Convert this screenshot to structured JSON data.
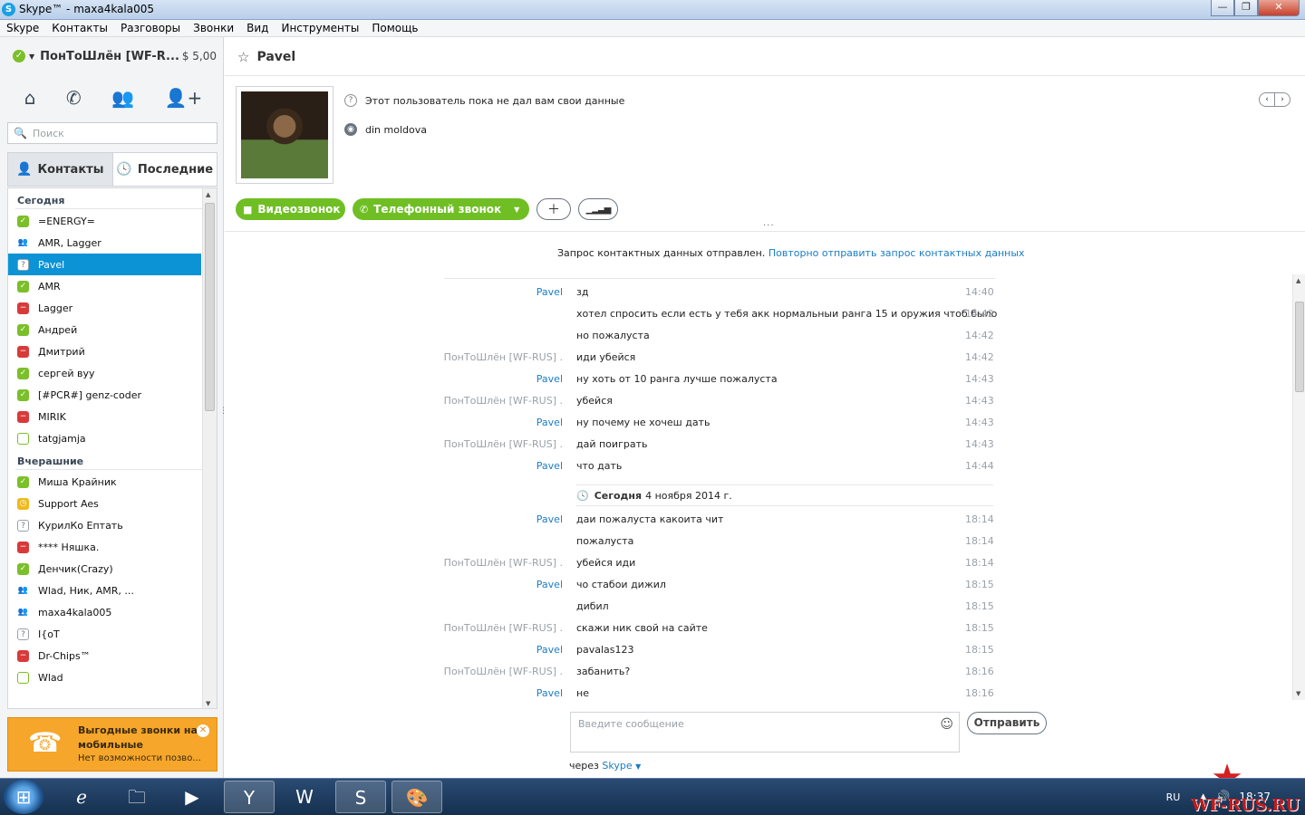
{
  "window": {
    "title": "Skype™ - maxa4kala005",
    "app_icon": "S"
  },
  "menu": [
    "Skype",
    "Контакты",
    "Разговоры",
    "Звонки",
    "Вид",
    "Инструменты",
    "Помощь"
  ],
  "account": {
    "name": "ПонТоШлён [WF-R...",
    "balance": "$ 5,00"
  },
  "search": {
    "placeholder": "Поиск"
  },
  "tabs": {
    "contacts": "Контакты",
    "recent": "Последние"
  },
  "contacts": {
    "today_header": "Сегодня",
    "today": [
      {
        "name": "=ENERGY=",
        "status": "online"
      },
      {
        "name": "AMR, Lagger",
        "status": "group"
      },
      {
        "name": "Pavel",
        "status": "pending",
        "selected": true
      },
      {
        "name": "AMR",
        "status": "online"
      },
      {
        "name": "Lagger",
        "status": "busy"
      },
      {
        "name": "Андрей",
        "status": "online"
      },
      {
        "name": "Дмитрий",
        "status": "busy"
      },
      {
        "name": "сергей вуу",
        "status": "online"
      },
      {
        "name": "[#PCR#] genz-coder",
        "status": "online"
      },
      {
        "name": "MIRIK",
        "status": "busy"
      },
      {
        "name": "tatgjamja",
        "status": "offline"
      }
    ],
    "yesterday_header": "Вчерашние",
    "yesterday": [
      {
        "name": "Миша Крайник",
        "status": "online"
      },
      {
        "name": "Support Aes",
        "status": "away"
      },
      {
        "name": "КурилКо Ептать",
        "status": "pending"
      },
      {
        "name": "**** Няшка.",
        "status": "busy"
      },
      {
        "name": "Денчик(Crazy)",
        "status": "online"
      },
      {
        "name": "Wlad, Ник, AMR, ...",
        "status": "group"
      },
      {
        "name": "maxa4kala005",
        "status": "group"
      },
      {
        "name": "I{oT",
        "status": "pending"
      },
      {
        "name": "Dr-Chips™",
        "status": "busy"
      },
      {
        "name": "Wlad",
        "status": "offline"
      }
    ]
  },
  "promo": {
    "title": "Выгодные звонки на мобильные",
    "subtitle": "Нет возможности позво..."
  },
  "profile": {
    "name": "Pavel",
    "info_line": "Этот пользователь пока не дал вам свои данные",
    "location": "din moldova"
  },
  "actions": {
    "video": "Видеозвонок",
    "phone": "Телефонный звонок"
  },
  "notice": {
    "text": "Запрос контактных данных отправлен.",
    "link": "Повторно отправить запрос контактных данных"
  },
  "messages": [
    {
      "from": "Pavel",
      "text": "зд",
      "time": "14:40"
    },
    {
      "from": "",
      "text": "хотел спросить если есть у тебя акк нормальныи ранга 15 и оружия чтоб было",
      "time": "14:42"
    },
    {
      "from": "",
      "text": "но пожалуста",
      "time": "14:42"
    },
    {
      "from": "ПонТоШлён [WF-RUS] .",
      "text": "иди убейся",
      "time": "14:42"
    },
    {
      "from": "Pavel",
      "text": "ну хоть от 10 ранга лучше пожалуста",
      "time": "14:43"
    },
    {
      "from": "ПонТоШлён [WF-RUS] .",
      "text": "убейся",
      "time": "14:43"
    },
    {
      "from": "Pavel",
      "text": "ну почему не хочеш дать",
      "time": "14:43"
    },
    {
      "from": "ПонТоШлён [WF-RUS] .",
      "text": "дай поиграть",
      "time": "14:43"
    },
    {
      "from": "Pavel",
      "text": "что дать",
      "time": "14:44"
    }
  ],
  "day_separator": {
    "label": "Сегодня",
    "date": "4 ноября 2014 г."
  },
  "messages2": [
    {
      "from": "Pavel",
      "text": "даи пожалуста какоита чит",
      "time": "18:14"
    },
    {
      "from": "",
      "text": "пожалуста",
      "time": "18:14"
    },
    {
      "from": "ПонТоШлён [WF-RUS] .",
      "text": "убейся иди",
      "time": "18:14"
    },
    {
      "from": "Pavel",
      "text": "чо стабои дижил",
      "time": "18:15"
    },
    {
      "from": "",
      "text": "дибил",
      "time": "18:15"
    },
    {
      "from": "ПонТоШлён [WF-RUS] .",
      "text": "скажи ник свой на сайте",
      "time": "18:15"
    },
    {
      "from": "Pavel",
      "text": "pavalas123",
      "time": "18:15"
    },
    {
      "from": "ПонТоШлён [WF-RUS] .",
      "text": "забанить?",
      "time": "18:16"
    },
    {
      "from": "Pavel",
      "text": "не",
      "time": "18:16"
    }
  ],
  "compose": {
    "placeholder": "Введите сообщение",
    "send": "Отправить",
    "via_prefix": "через",
    "via": "Skype"
  },
  "taskbar": {
    "lang": "RU",
    "clock": "18:37",
    "watermark": "WF-RUS.RU"
  },
  "colors": {
    "skype_blue": "#0c93d6",
    "online_green": "#7bbf2a",
    "busy_red": "#d83a3a",
    "promo_orange": "#f6a62a",
    "link_blue": "#1a7dc4"
  }
}
